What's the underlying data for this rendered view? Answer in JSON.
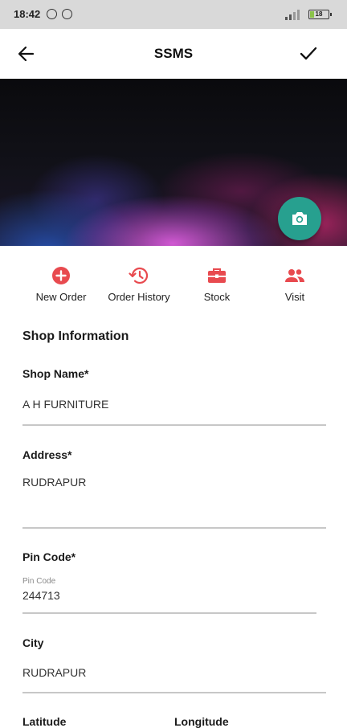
{
  "status_bar": {
    "time": "18:42",
    "battery": "18"
  },
  "app_bar": {
    "title": "SSMS"
  },
  "actions": [
    {
      "label": "New Order",
      "icon": "plus-circle-icon"
    },
    {
      "label": "Order History",
      "icon": "history-icon"
    },
    {
      "label": "Stock",
      "icon": "briefcase-icon"
    },
    {
      "label": "Visit",
      "icon": "people-icon"
    }
  ],
  "colors": {
    "accent": "#e84a4f",
    "fab": "#27a08f"
  },
  "form": {
    "section_title": "Shop Information",
    "shop_name": {
      "label": "Shop Name*",
      "value": "A H FURNITURE"
    },
    "address": {
      "label": "Address*",
      "value": "RUDRAPUR"
    },
    "pin_code": {
      "label": "Pin Code*",
      "hint": "Pin Code",
      "value": "244713"
    },
    "city": {
      "label": "City",
      "value": "RUDRAPUR"
    },
    "latitude": {
      "label": "Latitude"
    },
    "longitude": {
      "label": "Longitude"
    }
  }
}
